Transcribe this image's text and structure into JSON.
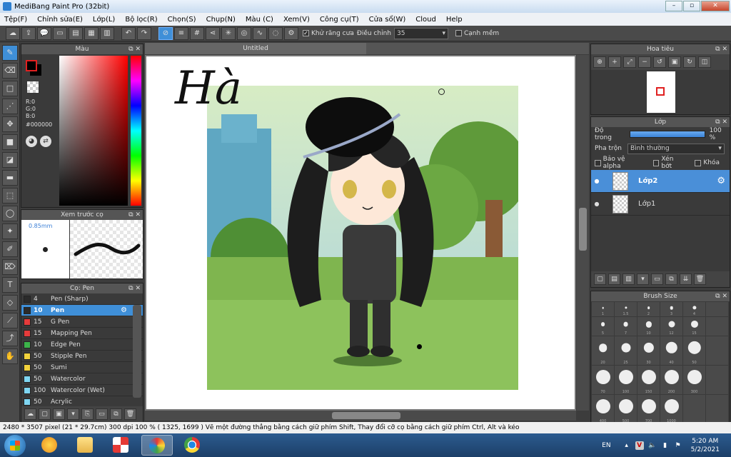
{
  "window": {
    "title": "MediBang Paint Pro (32bit)",
    "minimize": "–",
    "maximize": "▫",
    "close": "✕"
  },
  "menu": [
    "Tệp(F)",
    "Chỉnh sửa(E)",
    "Lớp(L)",
    "Bộ lọc(R)",
    "Chọn(S)",
    "Chụp(N)",
    "Màu (C)",
    "Xem(V)",
    "Công cụ(T)",
    "Cửa sổ(W)",
    "Cloud",
    "Help"
  ],
  "toolbar": {
    "antialias_label": "Khử răng cưa",
    "antialias_checked": "✓",
    "adjust_label": "Điều chỉnh",
    "adjust_value": "35",
    "smooth_label": "Cạnh mềm"
  },
  "color_panel": {
    "title": "Màu",
    "fg_color": "#000000",
    "rgb_lines": [
      "R:0",
      "G:0",
      "B:0"
    ],
    "hex": "#000000"
  },
  "brush_preview": {
    "title": "Xem trước cọ",
    "size": "0.85mm"
  },
  "brush_list": {
    "title": "Cọ: Pen",
    "items": [
      {
        "size": "4",
        "name": "Pen (Sharp)",
        "color": "#2b2b2b"
      },
      {
        "size": "10",
        "name": "Pen",
        "color": "#2b2b2b",
        "selected": true
      },
      {
        "size": "15",
        "name": "G Pen",
        "color": "#e53b3b"
      },
      {
        "size": "15",
        "name": "Mapping Pen",
        "color": "#e53b3b"
      },
      {
        "size": "10",
        "name": "Edge Pen",
        "color": "#3cb34a"
      },
      {
        "size": "50",
        "name": "Stipple Pen",
        "color": "#f2d23c"
      },
      {
        "size": "50",
        "name": "Sumi",
        "color": "#f2d23c"
      },
      {
        "size": "50",
        "name": "Watercolor",
        "color": "#7fd6f2"
      },
      {
        "size": "100",
        "name": "Watercolor (Wet)",
        "color": "#7fd6f2"
      },
      {
        "size": "50",
        "name": "Acrylic",
        "color": "#7fd6f2"
      }
    ]
  },
  "canvas": {
    "tab": "Untitled",
    "handwriting": "Hà"
  },
  "navigator": {
    "title": "Hoa tiêu"
  },
  "layers": {
    "title": "Lớp",
    "opacity_label": "Độ trong",
    "opacity_value": "100 %",
    "opacity": 1.0,
    "blend_label": "Pha trộn",
    "blend_value": "Bình thường",
    "options": [
      "Bảo vệ alpha",
      "Xén bớt",
      "Khóa"
    ],
    "items": [
      {
        "name": "Lớp2",
        "selected": true
      },
      {
        "name": "Lớp1",
        "selected": false
      }
    ]
  },
  "brush_size": {
    "title": "Brush Size",
    "sizes": [
      "1",
      "1.5",
      "2",
      "3",
      "4",
      "",
      "5",
      "7",
      "10",
      "12",
      "15",
      "",
      "20",
      "25",
      "30",
      "40",
      "50",
      "",
      "70",
      "100",
      "150",
      "200",
      "300",
      "",
      "400",
      "500",
      "700",
      "1000",
      "",
      ""
    ]
  },
  "status": {
    "text": "2480 * 3507 pixel   (21 * 29.7cm)   300 dpi   100 %   ( 1325, 1699 )   Vẽ một đường thẳng bằng cách giữ phím Shift, Thay đổi cỡ cọ bằng cách giữ phím Ctrl, Alt và kéo"
  },
  "taskbar": {
    "lang": "EN",
    "time": "5:20 AM",
    "date": "5/2/2021"
  }
}
